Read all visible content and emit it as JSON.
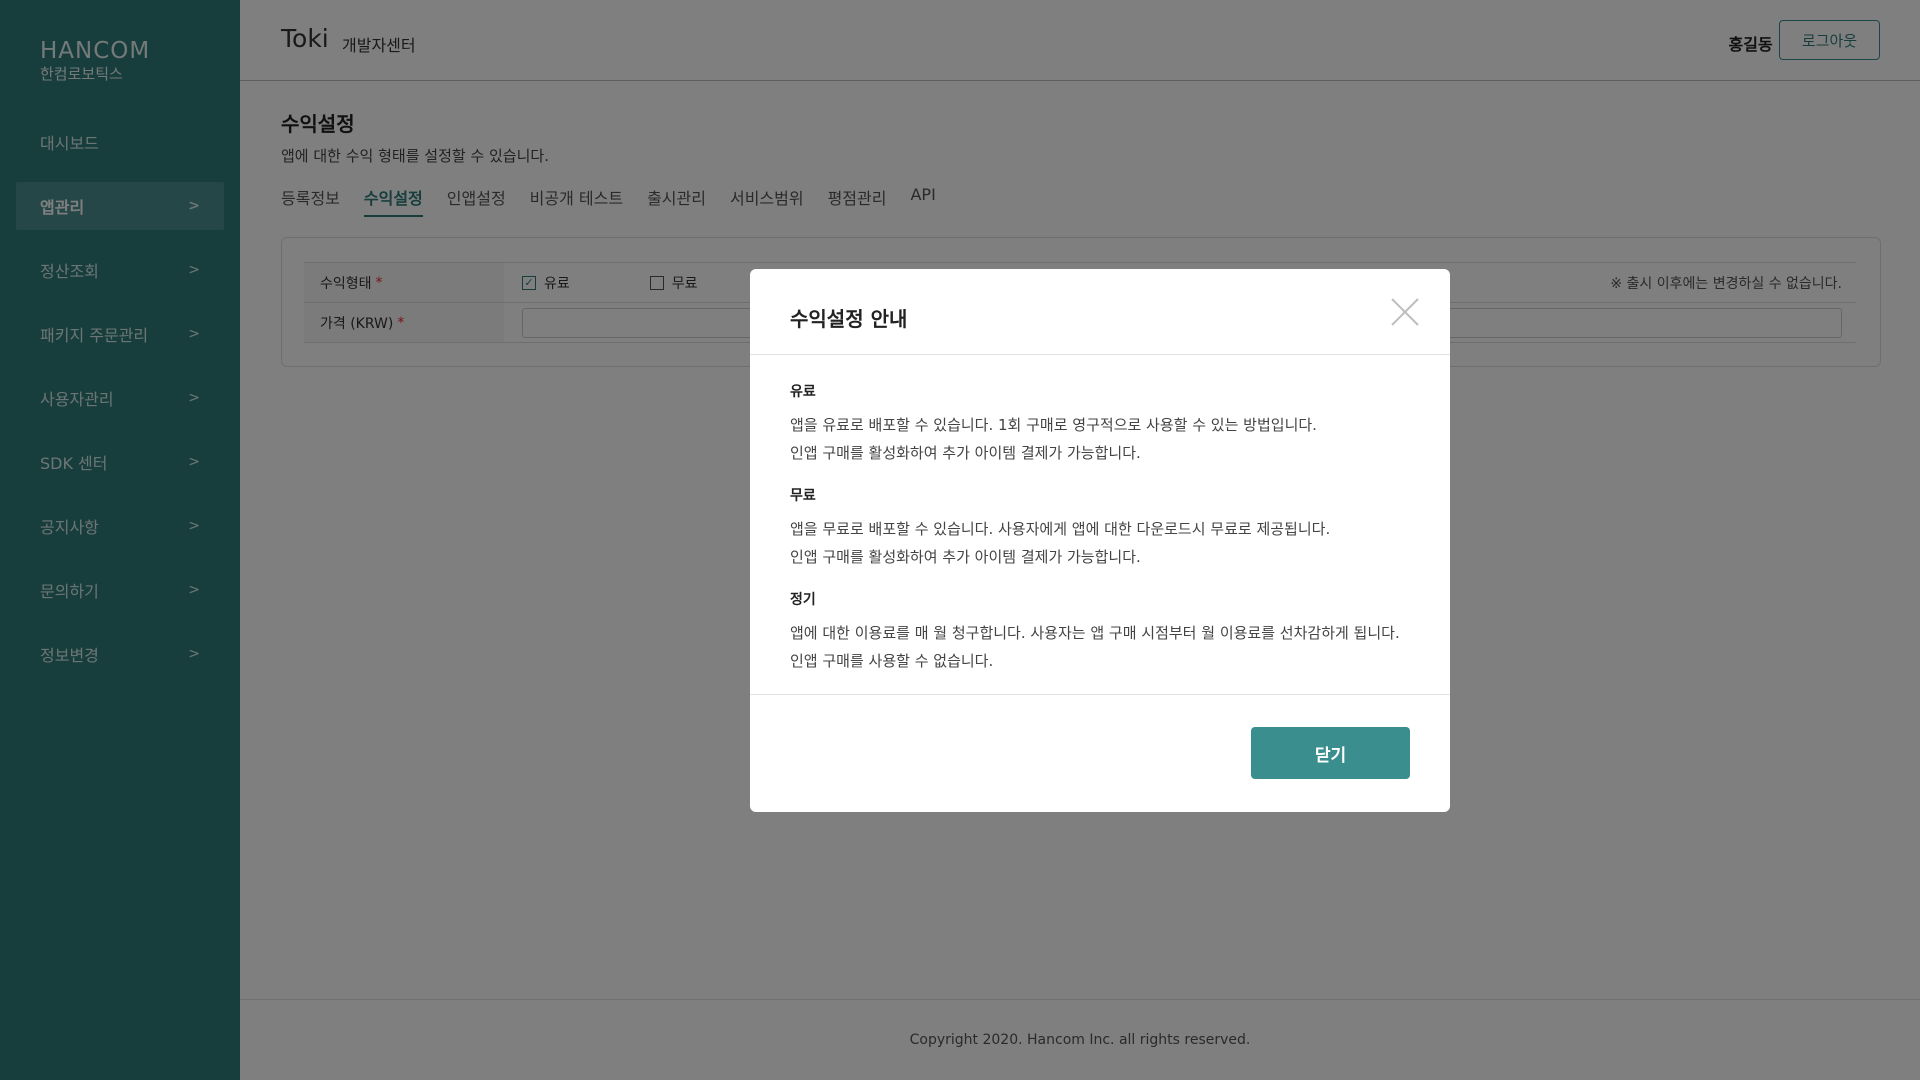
{
  "sidebar": {
    "logo_mark": "HANCOM",
    "logo_sub": "한컴로보틱스",
    "items": [
      {
        "label": "대시보드",
        "chevron": ""
      },
      {
        "label": "앱관리",
        "chevron": ">"
      },
      {
        "label": "정산조회",
        "chevron": ">"
      },
      {
        "label": "패키지 주문관리",
        "chevron": ">"
      },
      {
        "label": "사용자관리",
        "chevron": ">"
      },
      {
        "label": "SDK 센터",
        "chevron": ">"
      },
      {
        "label": "공지사항",
        "chevron": ">"
      },
      {
        "label": "문의하기",
        "chevron": ">"
      },
      {
        "label": "정보변경",
        "chevron": ">"
      }
    ]
  },
  "header": {
    "app_title": "Toki",
    "dev_center": "개발자센터",
    "user_name": "홍길동 님",
    "logout_label": "로그아웃"
  },
  "main": {
    "title": "수익설정",
    "description": "앱에 대한 수익 형태를 설정할 수 있습니다.",
    "tabs": [
      {
        "label": "등록정보"
      },
      {
        "label": "수익설정"
      },
      {
        "label": "인앱설정"
      },
      {
        "label": "비공개 테스트"
      },
      {
        "label": "출시관리"
      },
      {
        "label": "서비스범위"
      },
      {
        "label": "평점관리"
      },
      {
        "label": "API"
      }
    ],
    "form": {
      "revenue_label": "수익형태",
      "required_mark": "*",
      "option_paid": "유료",
      "option_free": "무료",
      "check_mark": "✓",
      "notice": "※ 출시 이후에는 변경하실 수 없습니다.",
      "price_label": "가격 (KRW)"
    }
  },
  "footer": {
    "copyright": "Copyright 2020. Hancom Inc. all rights reserved."
  },
  "modal": {
    "title": "수익설정 안내",
    "sections": [
      {
        "title": "유료",
        "line1": "앱을 유료로 배포할 수 있습니다. 1회 구매로 영구적으로 사용할 수 있는 방법입니다.",
        "line2": "인앱 구매를 활성화하여 추가 아이템 결제가 가능합니다."
      },
      {
        "title": "무료",
        "line1": "앱을 무료로 배포할 수 있습니다. 사용자에게 앱에 대한 다운로드시 무료로 제공됩니다.",
        "line2": "인앱 구매를 활성화하여 추가 아이템 결제가 가능합니다."
      },
      {
        "title": "정기",
        "line1": "앱에 대한 이용료를 매 월 청구합니다.  사용자는 앱 구매 시점부터 월 이용료를 선차감하게 됩니다.",
        "line2": "인앱 구매를 사용할 수 없습니다."
      }
    ],
    "close_label": "닫기"
  },
  "colors": {
    "brand": "#2f7c7b",
    "brand_light": "#3a8f8e",
    "required": "#ee2233"
  }
}
